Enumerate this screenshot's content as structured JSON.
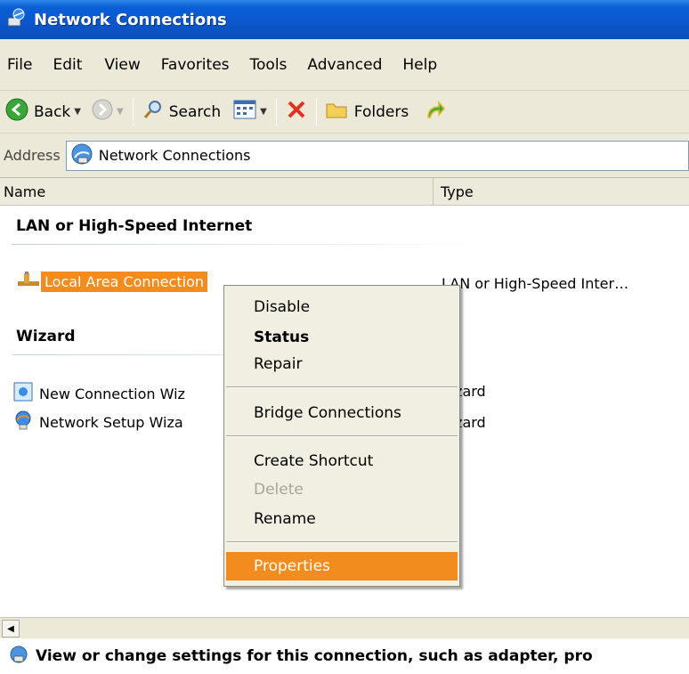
{
  "window": {
    "title": "Network Connections"
  },
  "menubar": {
    "items": [
      "File",
      "Edit",
      "View",
      "Favorites",
      "Tools",
      "Advanced",
      "Help"
    ]
  },
  "toolbar": {
    "back_label": "Back",
    "search_label": "Search",
    "folders_label": "Folders"
  },
  "address": {
    "label": "Address",
    "value": "Network Connections"
  },
  "columns": {
    "name": "Name",
    "type": "Type"
  },
  "groups": [
    {
      "header": "LAN or High-Speed Internet",
      "items": [
        {
          "name": "Local Area Connection",
          "type": "LAN or High-Speed Inter…",
          "icon": "network-cable-icon"
        }
      ]
    },
    {
      "header": "Wizard",
      "items": [
        {
          "name": "New Connection Wiz",
          "type": "Vizard",
          "icon": "new-connection-wizard-icon"
        },
        {
          "name": "Network Setup Wiza",
          "type": "Vizard",
          "icon": "network-setup-wizard-icon"
        }
      ]
    }
  ],
  "context_menu": {
    "disable": "Disable",
    "status": "Status",
    "repair": "Repair",
    "bridge": "Bridge Connections",
    "create_shortcut": "Create Shortcut",
    "delete": "Delete",
    "rename": "Rename",
    "properties": "Properties"
  },
  "statusbar": {
    "text": "View or change settings for this connection, such as adapter, pro"
  },
  "colors": {
    "titlebar": "#0b56cc",
    "selection": "#f28c1e",
    "chrome": "#ece9d8"
  }
}
